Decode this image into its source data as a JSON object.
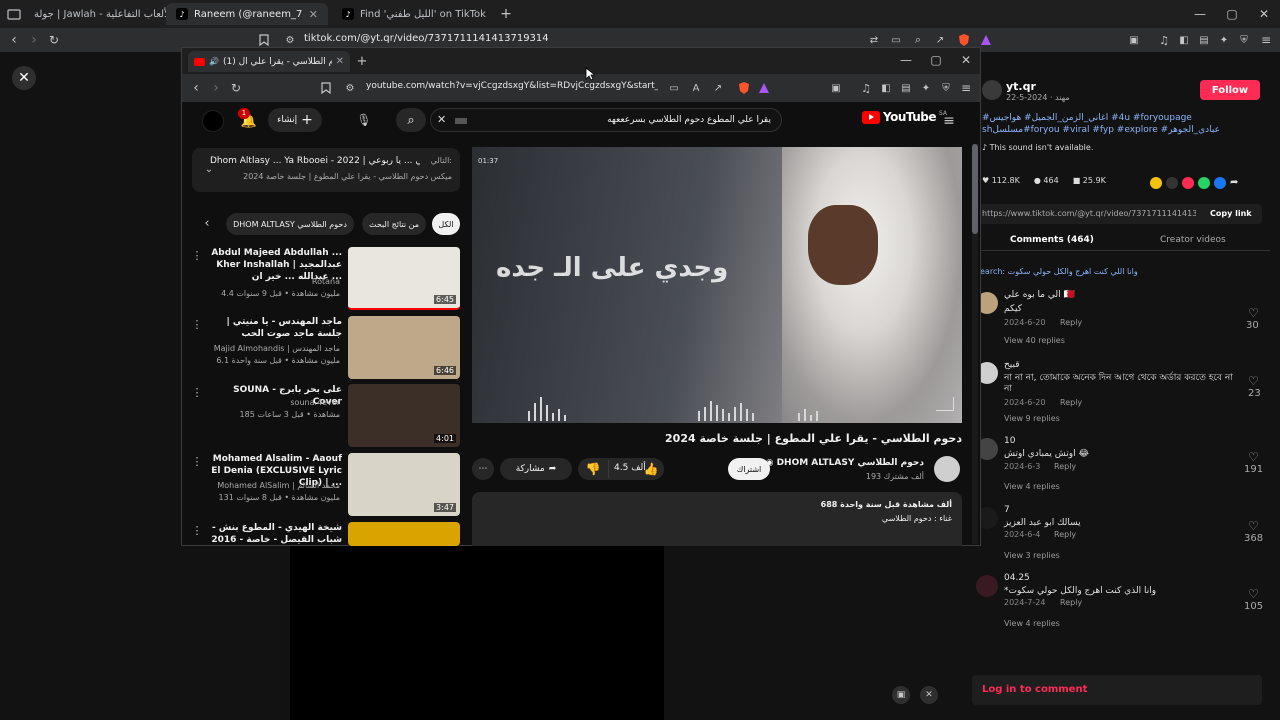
{
  "browser": {
    "tabs": [
      {
        "title": "جولة | Jawlah - منصة الألعاب التفاعلية"
      },
      {
        "title": "Raneem (@raneem_739) | TikTok"
      },
      {
        "title": "Find 'الليل طفني' on TikTok | TikTok Se"
      }
    ],
    "url": "tiktok.com/@yt.qr/video/7371711141413719314"
  },
  "tiktok": {
    "author": {
      "name": "yt.qr",
      "subtitle": "مهند · 2024-5-22",
      "follow_label": "Follow"
    },
    "caption": "#4u #foryoupage اغاني_الزمن_الجميل# هواجيس# عبادي_الجوهر# foryou #viral #fyp #explore#مسلسلsh",
    "sound_note": "This sound isn't available.",
    "stats": {
      "likes": "112.8K",
      "comments": "464",
      "saves": "25.9K"
    },
    "link": "https://www.tiktok.com/@yt.qr/video/7371711141413719...",
    "copy_link_label": "Copy link",
    "tabs": {
      "comments": "Comments (464)",
      "creator": "Creator videos"
    },
    "search_line": "earch: وانا اللي كنت اهرج والكل حولي سكوت",
    "comments": [
      {
        "name": "الي ما بوه علي 🇧🇭",
        "text": "كيكم",
        "date": "2024-6-20",
        "reply": "Reply",
        "likes": "30",
        "replies": "View 40 replies"
      },
      {
        "name": "قبيح",
        "text": "না না না, তোমাকে অনেক দিন আগে থেকে অর্ডার করতে হবে না না",
        "date": "2024-6-20",
        "reply": "Reply",
        "likes": "23",
        "replies": "View 9 replies"
      },
      {
        "name": "10",
        "text": "اوتش يمبادي اوتش 😂",
        "date": "2024-6-3",
        "reply": "Reply",
        "likes": "191",
        "replies": "View 4 replies"
      },
      {
        "name": "7",
        "text": "يسالك ابو عبد العزيز",
        "date": "2024-6-4",
        "reply": "Reply",
        "likes": "368",
        "replies": "View 3 replies"
      },
      {
        "name": "04.25",
        "text": "*وانا الذي كنت اهرج والكل حولي سكوت",
        "date": "2024-7-24",
        "reply": "Reply",
        "likes": "105",
        "replies": "View 4 replies"
      }
    ],
    "login_label": "Log in to comment"
  },
  "popup": {
    "tab_title": "(1) دحوم الطلاسي - يقرا علي ال",
    "url": "youtube.com/watch?v=vjCcgzdsxgY&list=RDvjCcgzdsxgY&start_radi...",
    "yt": {
      "logo_text": "YouTube",
      "logo_region": "SA",
      "search_query": "يقرا علي المطوع دحوم الطلاسي بسرعععهه",
      "create_label": "إنشاء",
      "notif_count": "1",
      "queue": {
        "label": "التالي:",
        "next": "Dhom Altlasy ... Ya Rbooei - 2022 | سي ... يا ربوعي",
        "sub": "ميكس دحوم الطلاسي - يقرا علي المطوع | جلسة خاصة 2024"
      },
      "chips": [
        "الكل",
        "من نتائج البحث",
        "DHOM ALTLASY دحوم الطلاسي"
      ],
      "list": [
        {
          "title": "Abdul Majeed Abdullah ... Kher Inshallah | عبدالمجيد عبدالله ... خير ان ...",
          "channel": "Rotana",
          "meta": "4.4 مليون مشاهدة • قبل 9 سنوات",
          "dur": "6:45"
        },
        {
          "title": "ماجد المهندس - يا منيتي | جلسة ماجد صوت الحب",
          "channel": "Majid Almohandis | ماجد المهندس",
          "meta": "6.1 مليون مشاهدة • قبل سنة واحدة",
          "dur": "6:46"
        },
        {
          "title": "SOUNA - على بحر بابرج Cover",
          "channel": "souna.4ever",
          "meta": "185 مشاهدة • قبل 3 ساعات",
          "dur": "4:01"
        },
        {
          "title": "Mohamed Alsalim - Aaouf El Denia (EXCLUSIVE Lyric Clip) | ...",
          "channel": "Mohamed AlSalim | محمد السالم",
          "meta": "131 مليون مشاهدة • قبل 8 سنوات",
          "dur": "3:47"
        },
        {
          "title": "شيخة الهيدي - المطوع بنش - شباب القيصل - خاصة - 2016 - طارق ميرزاته",
          "channel": "",
          "meta": "",
          "dur": ""
        }
      ],
      "video": {
        "timestamp": "01:37",
        "overlay_text": "وجدي على الـ جده",
        "title": "دحوم الطلاسي - يقرا علي المطوع | جلسة خاصة 2024",
        "channel": "DHOM ALTLASY دحوم الطلاسي",
        "subs": "193 ألف مشترك",
        "subscribe": "اشتراك",
        "likes": "4.5 ألف",
        "share": "مشاركة",
        "desc_stats": "688 ألف مشاهدة  قبل سنة واحدة",
        "desc_line": "غناء : دحوم الطلاسي"
      }
    }
  },
  "colors": {
    "tiktok_red": "#fe2c55",
    "link_blue": "#8ab4f8",
    "yt_red": "#ff0000"
  }
}
